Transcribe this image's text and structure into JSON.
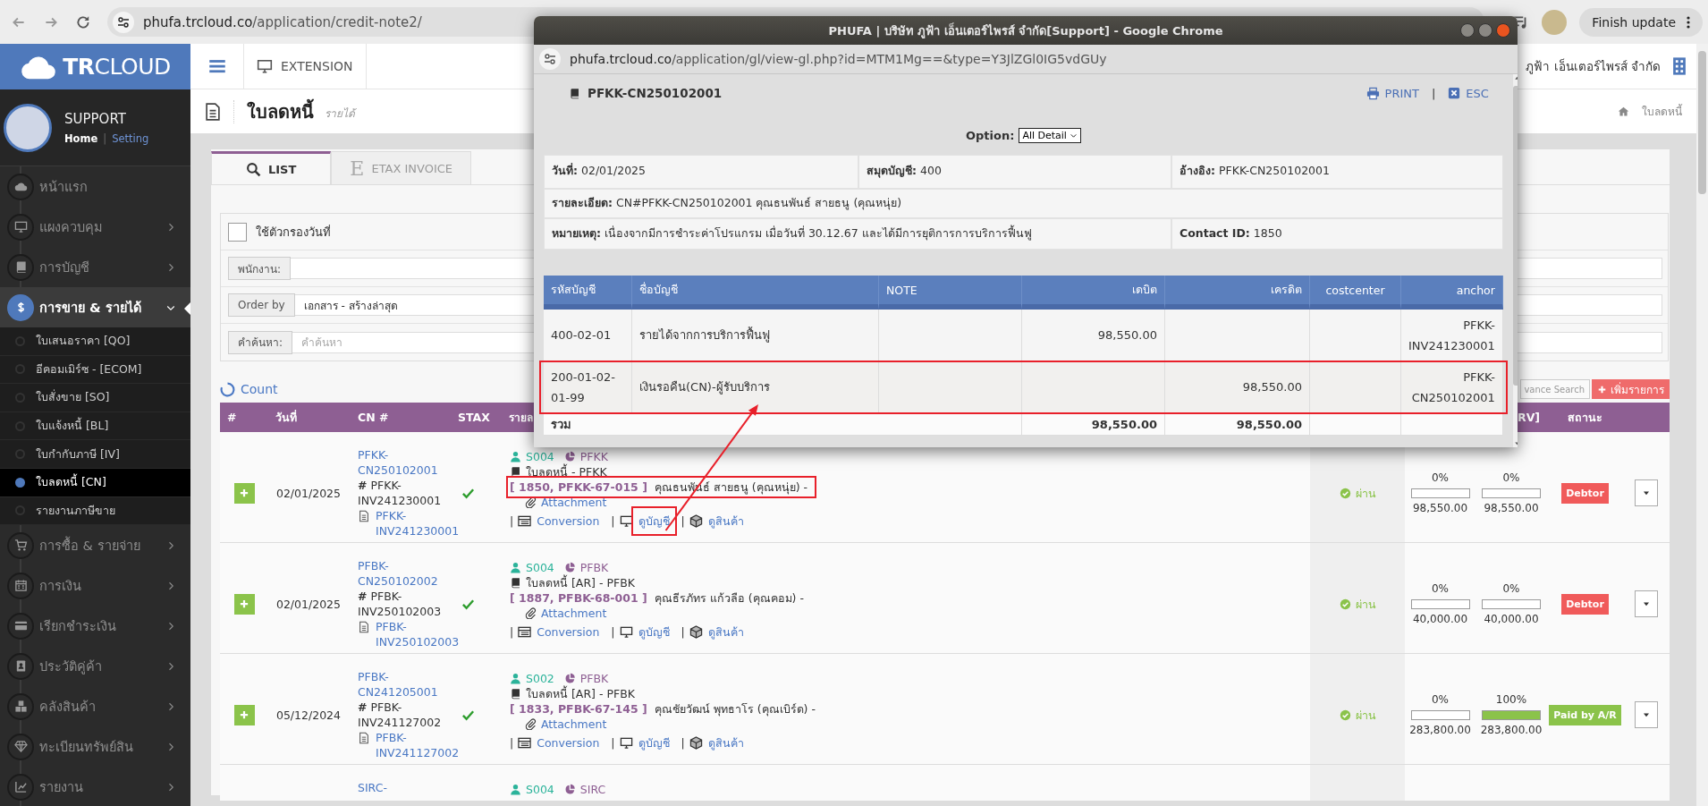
{
  "browser": {
    "url_host": "phufa.trcloud.co",
    "url_path": "/application/credit-note2/",
    "update_button": "Finish update"
  },
  "sidebar": {
    "logo": "**TR**CLOUD",
    "user": "SUPPORT",
    "home": "Home",
    "separator": "|",
    "setting": "Setting",
    "items": [
      {
        "label": "หน้าแรก",
        "kind": "link",
        "selected": false
      },
      {
        "label": "แผงควบคุม",
        "kind": "group",
        "expanded": false,
        "selected": false
      },
      {
        "label": "การบัญชี",
        "kind": "group",
        "expanded": false,
        "selected": false
      },
      {
        "label": "การขาย & รายได้",
        "kind": "group",
        "expanded": true,
        "selected": true,
        "children": [
          {
            "label": "ใบเสนอราคา [QO]",
            "selected": false
          },
          {
            "label": "อีคอมเมิร์ซ - [ECOM]",
            "selected": false
          },
          {
            "label": "ใบสั่งขาย [SO]",
            "selected": false
          },
          {
            "label": "ใบแจ้งหนี้ [BL]",
            "selected": false
          },
          {
            "label": "ใบกำกับภาษี [IV]",
            "selected": false
          },
          {
            "label": "ใบลดหนี้ [CN]",
            "selected": true
          },
          {
            "label": "รายงานภาษีขาย",
            "selected": false
          }
        ]
      },
      {
        "label": "การซื้อ & รายจ่าย",
        "kind": "group",
        "expanded": false,
        "selected": false
      },
      {
        "label": "การเงิน",
        "kind": "group",
        "expanded": false,
        "selected": false
      },
      {
        "label": "เรียกชำระเงิน",
        "kind": "group",
        "expanded": false,
        "selected": false
      },
      {
        "label": "ประวัติคู่ค้า",
        "kind": "group",
        "expanded": false,
        "selected": false
      },
      {
        "label": "คลังสินค้า",
        "kind": "group",
        "expanded": false,
        "selected": false
      },
      {
        "label": "ทะเบียนทรัพย์สิน",
        "kind": "group",
        "expanded": false,
        "selected": false
      },
      {
        "label": "รายงาน",
        "kind": "group",
        "expanded": false,
        "selected": false
      }
    ]
  },
  "topnav": {
    "extension": "EXTENSION",
    "company": "ภูฟ้า เอ็นเตอร์ไพรส์ จำกัด"
  },
  "page": {
    "title": "ใบลดหนี้",
    "subtitle": "รายได้",
    "breadcrumb": "ใบลดหนี้"
  },
  "tabs": [
    {
      "label": "LIST",
      "selected": true
    },
    {
      "label": "ETAX INVOICE",
      "glyph": "E",
      "selected": false
    }
  ],
  "filters": {
    "date_filter": {
      "label": "ใช้ตัวกรองวันที่",
      "checked": false
    },
    "staff": {
      "label": "พนักงาน:"
    },
    "order": {
      "label": "Order by",
      "value": "เอกสาร - สร้างล่าสุด"
    },
    "search": {
      "label": "คำค้นหา:",
      "placeholder": "คำค้นหา"
    }
  },
  "count": "Count",
  "advance_search": "vance Search",
  "add_button": "เพิ่มรายการ",
  "table": {
    "columns": {
      "number": "#",
      "date": "วันที่",
      "cn": "CN #",
      "stax": "STAX",
      "detail": "รายล",
      "column_8": "RV]",
      "status": "สถานะ"
    },
    "rows": [
      {
        "date": "02/01/2025",
        "cn": "PFKK-CN250102001",
        "invoice": "**#** PFKK-INV241230001",
        "doc": "PFKK-INV241230001",
        "stax": true,
        "staff": "S004",
        "branch": "PFKK",
        "doc_type": "ใบลดหนี้ - PFKK",
        "ref": "[ 1850, PFKK-67-015 ]",
        "customer": "คุณธนพันธ์ สายธนู (คุณหนุ่ย) -",
        "highlighted": true,
        "attachment": "Attachment",
        "links": [
          {
            "sep": "|",
            "label": "Conversion",
            "highlighted": false
          },
          {
            "sep": "|",
            "label": "ดูบัญชี",
            "highlighted": true
          },
          {
            "sep": "|",
            "label": "ดูสินค้า",
            "highlighted": false
          }
        ],
        "approval": "ผ่าน",
        "progress": [
          {
            "pct": "0%",
            "level": 0,
            "amount": "98,550.00"
          },
          {
            "pct": "0%",
            "level": 0,
            "amount": "98,550.00"
          }
        ],
        "status": {
          "label": "Debtor",
          "kind": "debtor"
        }
      },
      {
        "date": "02/01/2025",
        "cn": "PFBK-CN250102002",
        "invoice": "**#** PFBK-INV250102003",
        "doc": "PFBK-INV250102003",
        "stax": true,
        "staff": "S004",
        "branch": "PFBK",
        "doc_type": "ใบลดหนี้ [AR] - PFBK",
        "ref": "[ 1887, PFBK-68-001 ]",
        "customer": "คุณธีรภัทร แก้วลือ (คุณคอม) -",
        "highlighted": false,
        "attachment": "Attachment",
        "links": [
          {
            "sep": "|",
            "label": "Conversion",
            "highlighted": false
          },
          {
            "sep": "|",
            "label": "ดูบัญชี",
            "highlighted": false
          },
          {
            "sep": "|",
            "label": "ดูสินค้า",
            "highlighted": false
          }
        ],
        "approval": "ผ่าน",
        "progress": [
          {
            "pct": "0%",
            "level": 0,
            "amount": "40,000.00"
          },
          {
            "pct": "0%",
            "level": 0,
            "amount": "40,000.00"
          }
        ],
        "status": {
          "label": "Debtor",
          "kind": "debtor"
        }
      },
      {
        "date": "05/12/2024",
        "cn": "PFBK-CN241205001",
        "invoice": "**#** PFBK-INV241127002",
        "doc": "PFBK-INV241127002",
        "stax": true,
        "staff": "S002",
        "branch": "PFBK",
        "doc_type": "ใบลดหนี้ [AR] - PFBK",
        "ref": "[ 1833, PFBK-67-145 ]",
        "customer": "คุณชัยวัฒน์ พุทธาโร (คุณเบิร์ด) -",
        "highlighted": false,
        "attachment": "Attachment",
        "links": [
          {
            "sep": "|",
            "label": "Conversion",
            "highlighted": false
          },
          {
            "sep": "|",
            "label": "ดูบัญชี",
            "highlighted": false
          },
          {
            "sep": "|",
            "label": "ดูสินค้า",
            "highlighted": false
          }
        ],
        "approval": "ผ่าน",
        "progress": [
          {
            "pct": "0%",
            "level": 0,
            "amount": "283,800.00"
          },
          {
            "pct": "100%",
            "level": 1,
            "amount": "283,800.00"
          }
        ],
        "status": {
          "label": "Paid by A/R",
          "kind": "paid"
        }
      },
      {
        "cn": "SIRC-",
        "staff": "S004",
        "branch": "SIRC"
      }
    ]
  },
  "popup": {
    "title": "PHUFA | บริษัท ภูฟ้า เอ็นเตอร์ไพรส์ จำกัด[Support] - Google Chrome",
    "url_host": "phufa.trcloud.co",
    "url_path": "/application/gl/view-gl.php?id=MTM1Mg==&type=Y3JlZGl0IG5vdGUy",
    "doc": "PFKK-CN250102001",
    "print": "PRINT",
    "sep": "|",
    "esc": "ESC",
    "option_label": "Option:",
    "option_value": "All Detail",
    "info": [
      [
        "**วันที่:** 02/01/2025",
        "**สมุดบัญชี:** 400",
        "**อ้างอิง:** PFKK-CN250102001"
      ],
      [
        "**รายละเอียด:** CN#PFKK-CN250102001 คุณธนพันธ์ สายธนู (คุณหนุ่ย)"
      ],
      [
        "**หมายเหตุ:** เนื่องจากมีการชำระค่าโปรแกรม เมื่อวันที่ 30.12.67 และได้มีการยุติการการบริการฟื้นฟู",
        "**Contact ID:** 1850"
      ]
    ],
    "columns": [
      "รหัสบัญชี",
      "ชื่อบัญชี",
      "NOTE",
      "เดบิต",
      "เครดิต",
      "costcenter",
      "anchor"
    ],
    "rows": [
      {
        "code": "400-02-01",
        "name": "รายได้จากการบริการฟื้นฟู",
        "debit": "98,550.00",
        "anchor": "PFKK-INV241230001",
        "highlighted": false
      },
      {
        "code": "200-01-02-01-99",
        "name": "เงินรอคืน(CN)-ผู้รับบริการ",
        "credit": "98,550.00",
        "anchor": "PFKK-CN250102001",
        "highlighted": true
      }
    ],
    "total": {
      "label": "รวม",
      "debit": "98,550.00",
      "credit": "98,550.00"
    }
  },
  "annotations": {
    "arrow": true
  }
}
